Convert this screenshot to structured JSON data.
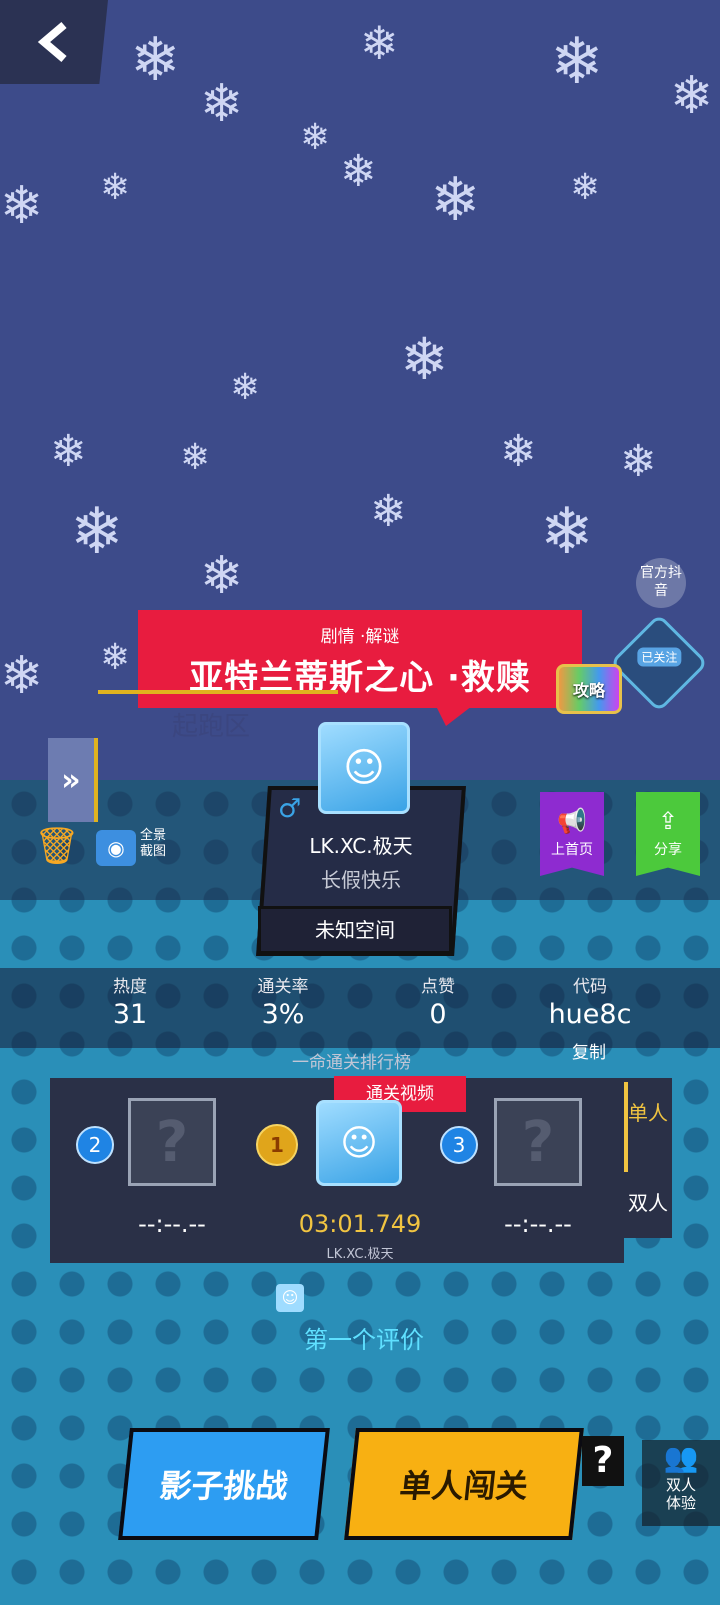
{
  "level": {
    "tags": "剧情 ·解谜",
    "title": "亚特兰蒂斯之心 ·救赎",
    "start_zone_label": "起跑区"
  },
  "corner": {
    "official": "官方抖音",
    "strategy": "攻略",
    "followed": "已关注"
  },
  "author": {
    "gender_icon": "♂",
    "name": "LK.XC.极天",
    "signature": "长假快乐",
    "space": "未知空间"
  },
  "tools": {
    "panorama": "全景截图"
  },
  "actions": {
    "feature": "上首页",
    "share": "分享"
  },
  "stats": {
    "heat_label": "热度",
    "heat": "31",
    "clear_rate_label": "通关率",
    "clear_rate": "3%",
    "likes_label": "点赞",
    "likes": "0",
    "code_label": "代码",
    "code": "hue8c",
    "copy": "复制"
  },
  "leaderboard": {
    "title": "一命通关排行榜",
    "video_tag": "通关视频",
    "ranks": [
      {
        "rank": "2",
        "time": "--:--.--"
      },
      {
        "rank": "1",
        "time": "03:01.749",
        "player": "LK.XC.极天"
      },
      {
        "rank": "3",
        "time": "--:--.--"
      }
    ],
    "tabs": [
      "单人",
      "双人"
    ]
  },
  "comment": {
    "text": "第一个评价"
  },
  "buttons": {
    "shadow": "影子挑战",
    "solo": "单人闯关",
    "help": "?",
    "duo": "双人体验"
  },
  "colors": {
    "sky": "#3d4b8a",
    "banner": "#e81c3f",
    "feature": "#8e2bd0",
    "share": "#4cc93c",
    "shadow_btn": "#2d9df2",
    "solo_btn": "#f8b012"
  }
}
